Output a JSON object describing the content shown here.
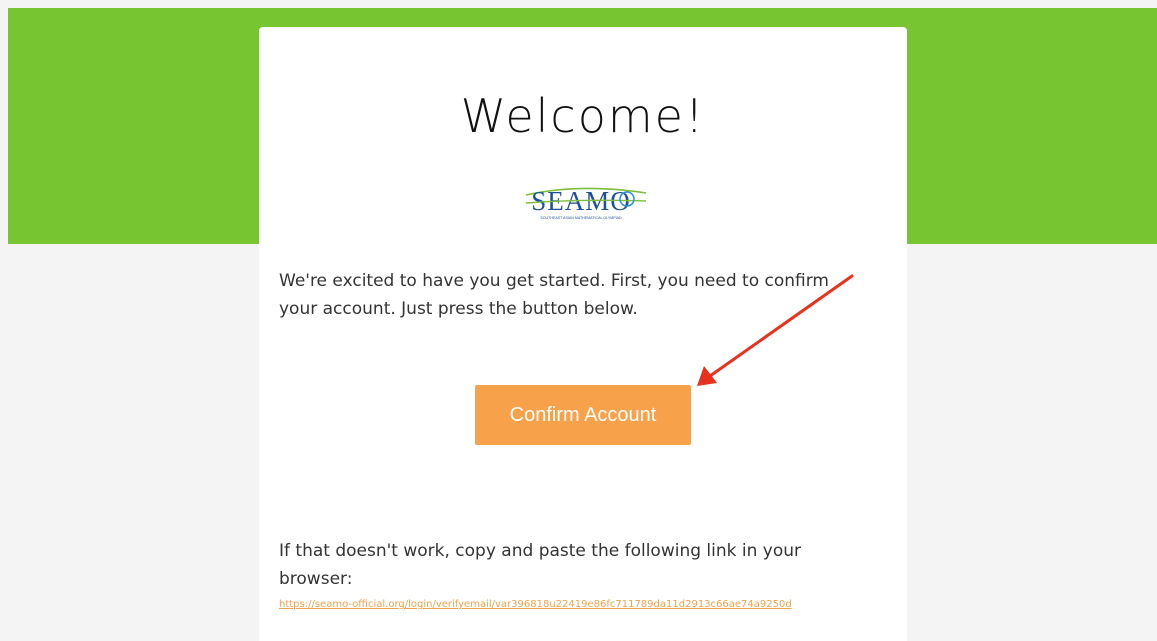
{
  "colors": {
    "header_band": "#77c531",
    "page_background": "#f4f4f4",
    "card_background": "#ffffff",
    "button": "#f7a24a",
    "link": "#f0a24a",
    "annotation_arrow": "#e8321e"
  },
  "email": {
    "headline": "Welcome!",
    "logo": {
      "icon": "seamo-logo",
      "wordmark": "SEAMO",
      "tagline": "SOUTHEAST ASIAN MATHEMATICAL OLYMPIAD"
    },
    "intro_text": "We're excited to have you get started. First, you need to confirm your account. Just press the button below.",
    "confirm_button_label": "Confirm Account",
    "fallback_text": "If that doesn't work, copy and paste the following link in your browser:",
    "verify_link": "https://seamo-official.org/login/verifyemail/var396818u22419e86fc711789da11d2913c66ae74a9250d"
  },
  "annotation": {
    "icon": "red-arrow-pointing-to-button"
  }
}
